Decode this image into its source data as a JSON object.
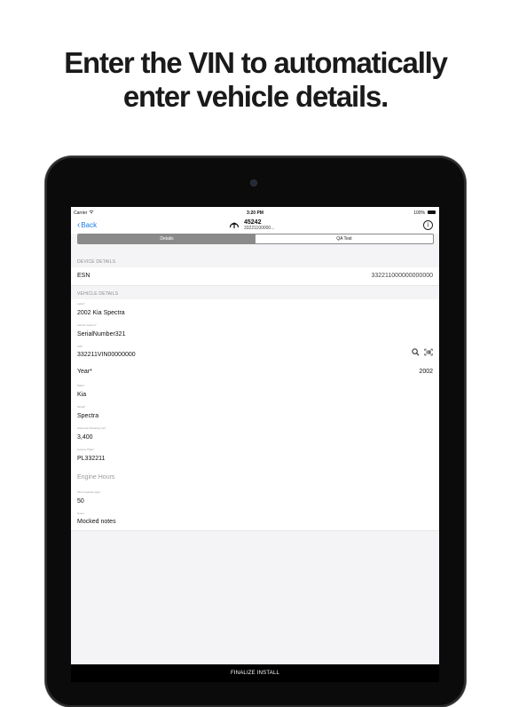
{
  "headline": {
    "line1": "Enter the VIN to automatically",
    "line2": "enter vehicle details."
  },
  "status_bar": {
    "carrier": "Carrier",
    "time": "3:20 PM",
    "battery": "100%"
  },
  "nav": {
    "back_label": "Back",
    "device_id": "45242",
    "device_sub": "33221100000...",
    "gauge_icon": "gauge-icon",
    "info_icon": "info-icon"
  },
  "segments": {
    "details": "Details",
    "qa_test": "QA Test"
  },
  "device_section": {
    "header": "DEVICE DETAILS",
    "esn_label": "ESN",
    "esn_value": "332211000000000000"
  },
  "vehicle_section": {
    "header": "VEHICLE DETAILS",
    "label_field": {
      "caption": "Label*",
      "value": "2002 Kia Spectra"
    },
    "serial_field": {
      "caption": "Vehicle System*",
      "value": "SerialNumber321"
    },
    "vin_field": {
      "caption": "VIN*",
      "value": "332211VIN00000000"
    },
    "year_field": {
      "label": "Year*",
      "value": "2002"
    },
    "make_field": {
      "caption": "Make*",
      "value": "Kia"
    },
    "model_field": {
      "caption": "Model*",
      "value": "Spectra"
    },
    "odometer_field": {
      "caption": "Odometer Reading (mi)*",
      "value": "3,400"
    },
    "plate_field": {
      "caption": "License Plate*",
      "value": "PL332211"
    },
    "engine_hours_placeholder": "Engine Hours",
    "tank_field": {
      "caption": "Tank Capacity (gal)",
      "value": "50"
    },
    "notes_field": {
      "caption": "Notes",
      "value": "Mocked notes"
    }
  },
  "footer": {
    "finalize_label": "FINALIZE INSTALL"
  },
  "colors": {
    "accent": "#1a7ae6",
    "segment_active": "#8a8a8a",
    "footer_bg": "#000000"
  }
}
